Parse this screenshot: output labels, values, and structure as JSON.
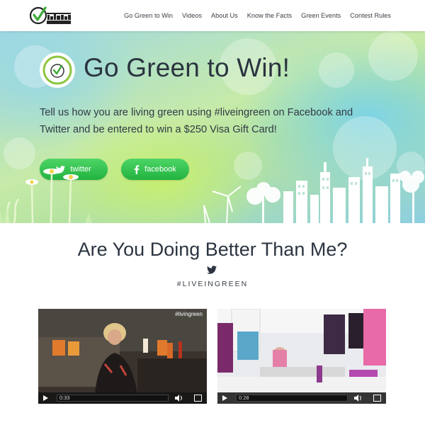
{
  "nav": {
    "items": [
      "Go Green to Win",
      "Videos",
      "About Us",
      "Know the Facts",
      "Green Events",
      "Contest Rules"
    ]
  },
  "hero": {
    "title": "Go Green to Win!",
    "text": "Tell us how you are living green using #liveingreen on Facebook and Twitter and be entered to win a $250 Visa Gift Card!",
    "buttons": {
      "twitter": "twitter",
      "facebook": "facebook"
    }
  },
  "section": {
    "title": "Are You Doing Better Than Me?",
    "hashtag": "#LIVEINGREEN"
  },
  "videos": [
    {
      "tag": "#livingreen",
      "time": "0:33"
    },
    {
      "tag": "",
      "time": "0:28"
    }
  ],
  "colors": {
    "button_green": "#2bbd47",
    "logo_green": "#3aa935",
    "text_dark": "#2b3440"
  },
  "icons": [
    "twitter-icon",
    "facebook-icon",
    "play-icon",
    "volume-icon",
    "fullscreen-icon",
    "check-icon"
  ]
}
